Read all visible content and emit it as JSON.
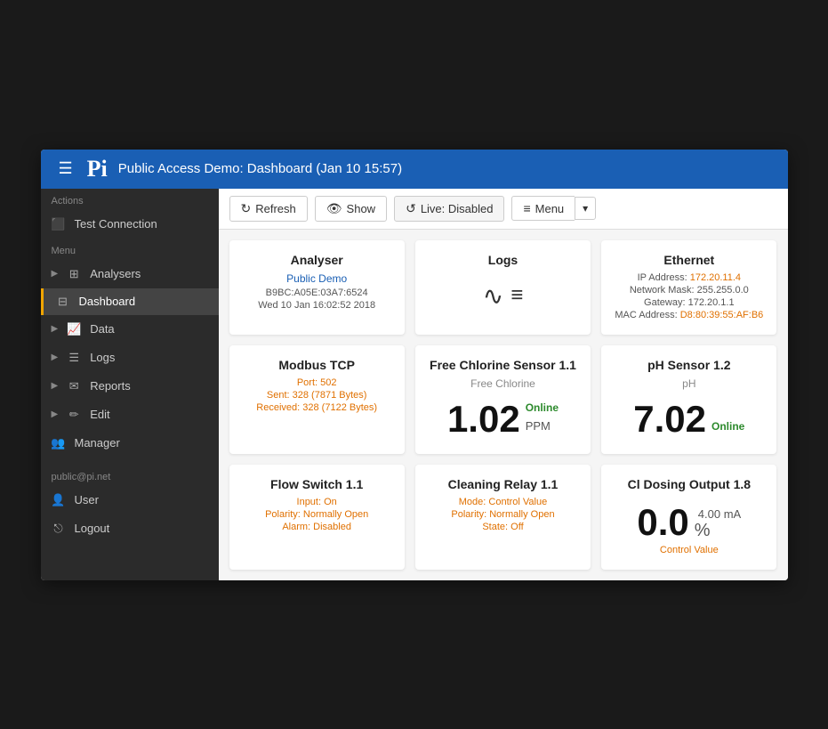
{
  "header": {
    "menu_label": "☰",
    "logo": "Pi",
    "title": "Public Access Demo: Dashboard (Jan 10 15:57)"
  },
  "sidebar": {
    "actions_label": "Actions",
    "test_connection": "Test Connection",
    "menu_label": "Menu",
    "items": [
      {
        "id": "analysers",
        "label": "Analysers",
        "icon": "⊞",
        "arrow": "▶",
        "active": false
      },
      {
        "id": "dashboard",
        "label": "Dashboard",
        "icon": "⊟",
        "active": true,
        "highlighted": true
      },
      {
        "id": "data",
        "label": "Data",
        "icon": "📈",
        "arrow": "▶",
        "active": false
      },
      {
        "id": "logs",
        "label": "Logs",
        "icon": "☰",
        "arrow": "▶",
        "active": false
      },
      {
        "id": "reports",
        "label": "Reports",
        "icon": "✉",
        "arrow": "▶",
        "active": false
      },
      {
        "id": "edit",
        "label": "Edit",
        "icon": "✏",
        "arrow": "▶",
        "active": false
      },
      {
        "id": "manager",
        "label": "Manager",
        "icon": "👥",
        "active": false
      }
    ],
    "user_email": "public@pi.net",
    "user_label": "User",
    "user_icon": "👤",
    "logout_label": "Logout",
    "logout_icon": "⎋"
  },
  "toolbar": {
    "refresh_label": "Refresh",
    "show_label": "Show",
    "live_label": "Live: Disabled",
    "menu_label": "Menu"
  },
  "cards": {
    "analyser": {
      "title": "Analyser",
      "name": "Public Demo",
      "id": "B9BC:A05E:03A7:6524",
      "timestamp": "Wed 10 Jan 16:02:52 2018"
    },
    "logs": {
      "title": "Logs"
    },
    "ethernet": {
      "title": "Ethernet",
      "ip_label": "IP Address:",
      "ip_value": "172.20.11.4",
      "mask_label": "Network Mask:",
      "mask_value": "255.255.0.0",
      "gateway_label": "Gateway:",
      "gateway_value": "172.20.1.1",
      "mac_label": "MAC Address:",
      "mac_value": "D8:80:39:55:AF:B6"
    },
    "modbus": {
      "title": "Modbus TCP",
      "port_label": "Port:",
      "port_value": "502",
      "sent_label": "Sent:",
      "sent_value": "328 (7871 Bytes)",
      "received_label": "Received:",
      "received_value": "328 (7122 Bytes)"
    },
    "free_chlorine": {
      "title": "Free Chlorine Sensor 1.1",
      "subtitle": "Free Chlorine",
      "value": "1.02",
      "unit": "PPM",
      "status": "Online"
    },
    "ph_sensor": {
      "title": "pH Sensor 1.2",
      "subtitle": "pH",
      "value": "7.02",
      "status": "Online"
    },
    "flow_switch": {
      "title": "Flow Switch 1.1",
      "input_label": "Input:",
      "input_value": "On",
      "polarity_label": "Polarity:",
      "polarity_value": "Normally Open",
      "alarm_label": "Alarm:",
      "alarm_value": "Disabled"
    },
    "cleaning_relay": {
      "title": "Cleaning Relay 1.1",
      "mode_label": "Mode:",
      "mode_value": "Control Value",
      "polarity_label": "Polarity:",
      "polarity_value": "Normally Open",
      "state_label": "State:",
      "state_value": "Off"
    },
    "cl_dosing": {
      "title": "Cl Dosing Output 1.8",
      "value": "0.0",
      "secondary_value": "4.00 mA",
      "unit": "%",
      "footer": "Control Value"
    }
  }
}
